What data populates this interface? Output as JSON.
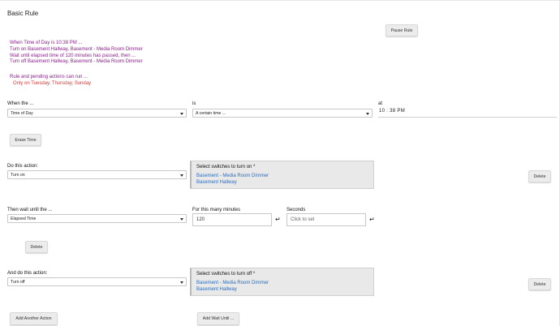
{
  "page": {
    "title": "Basic Rule"
  },
  "buttons": {
    "pause": "Pause Rule",
    "erase_time": "Erase Time",
    "delete1": "Delete",
    "delete2": "Delete",
    "delete3": "Delete",
    "add_action": "Add Another Action",
    "add_wait": "Add Wait Until ..."
  },
  "summary": {
    "lines": [
      "When Time of Day is 10:38 PM ...",
      "Turn on Basement Hallway, Basement - Media Room Dimmer",
      "Wait until elapsed time of 120 minutes has passed, then ...",
      "Turn off Basement Hallway, Basement - Media Room Dimmer"
    ],
    "restriction_title": "Rule and pending actions can run ...",
    "restriction_detail": "Only on Tuesday, Thursday, Sunday"
  },
  "when": {
    "label": "When the ...",
    "value": "Time of Day",
    "is_label": "is",
    "is_value": "A certain time ...",
    "at_label": "at",
    "time_value": "10 : 38  PM"
  },
  "action1": {
    "label": "Do this action:",
    "value": "Turn on",
    "panel_title": "Select switches to turn on *",
    "items": [
      "Basement - Media Room Dimmer",
      "Basement Hallway"
    ]
  },
  "wait": {
    "label": "Then wait until the ...",
    "value": "Elapsed Time",
    "minutes_label": "For this many minutes",
    "minutes_value": "120",
    "seconds_label": "Seconds",
    "seconds_placeholder": "Click to set"
  },
  "action2": {
    "label": "And do this action:",
    "value": "Turn off",
    "panel_title": "Select switches to turn off *",
    "items": [
      "Basement - Media Room Dimmer",
      "Basement Hallway"
    ]
  },
  "colors": {
    "summary": "#8a1f8a",
    "restriction": "#d83a3a",
    "link": "#2b6fbf"
  },
  "icons": {
    "enter": "enter-key-icon",
    "dropdown": "chevron-down-icon"
  }
}
